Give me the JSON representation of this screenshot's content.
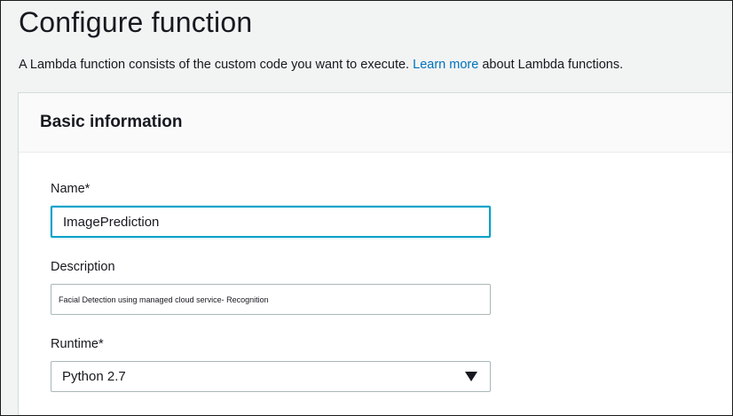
{
  "page": {
    "title": "Configure function",
    "description_prefix": "A Lambda function consists of the custom code you want to execute.",
    "learn_more_link": "Learn more",
    "description_suffix": "about Lambda functions."
  },
  "basic_information": {
    "title": "Basic information",
    "name": {
      "label": "Name*",
      "value": "ImagePrediction"
    },
    "description": {
      "label": "Description",
      "value": "Facial Detection using managed cloud service- Recognition"
    },
    "runtime": {
      "label": "Runtime*",
      "selected": "Python 2.7",
      "icon": "chevron-down-icon"
    }
  },
  "colors": {
    "link": "#0073bb",
    "focus_border": "#00a1c9",
    "text": "#16191f",
    "page_background": "#f2f3f3"
  }
}
